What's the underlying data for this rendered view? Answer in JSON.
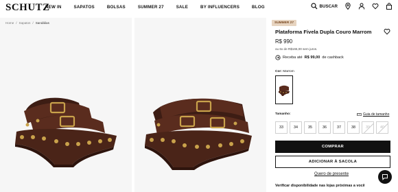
{
  "header": {
    "logo": "SCHUTZ",
    "nav": [
      "NEW IN",
      "SAPATOS",
      "BOLSAS",
      "SUMMER 27",
      "SALE",
      "BY INFLUENCERS",
      "BLOG"
    ],
    "search_label": "BUSCAR",
    "icons": [
      "search-icon",
      "location-icon",
      "user-icon",
      "heart-icon",
      "bag-icon"
    ]
  },
  "breadcrumb": [
    "Home",
    "Sapatos",
    "Sandálias"
  ],
  "product": {
    "badge": "SUMMER 27",
    "title": "Plataforma Fivela Dupla Couro Marrom",
    "price": "R$ 990",
    "installments": "ou 6x de R$165,00 sem juros.",
    "cashback_prefix": "Receba até",
    "cashback_value": "R$ 99,00",
    "cashback_suffix": "de cashback",
    "color_label": "Cor:",
    "color_value": "Marrom",
    "size_label": "Tamanho:",
    "size_guide": "Guia de tamanho",
    "sizes": [
      "33",
      "34",
      "35",
      "36",
      "37",
      "38",
      "39",
      "40"
    ],
    "buy_label": "COMPRAR",
    "cart_label": "ADICIONAR À SACOLA",
    "gift_label": "Quero de presente",
    "availability": "Verificar disponibilidade nas lojas próximas a você"
  },
  "colors": {
    "accent_badge_bg": "#e7d4c0",
    "accent_badge_text": "#7a4a22",
    "primary": "#111111",
    "shoe_brown": "#4a2418",
    "stud_gold": "#c9a24b"
  }
}
